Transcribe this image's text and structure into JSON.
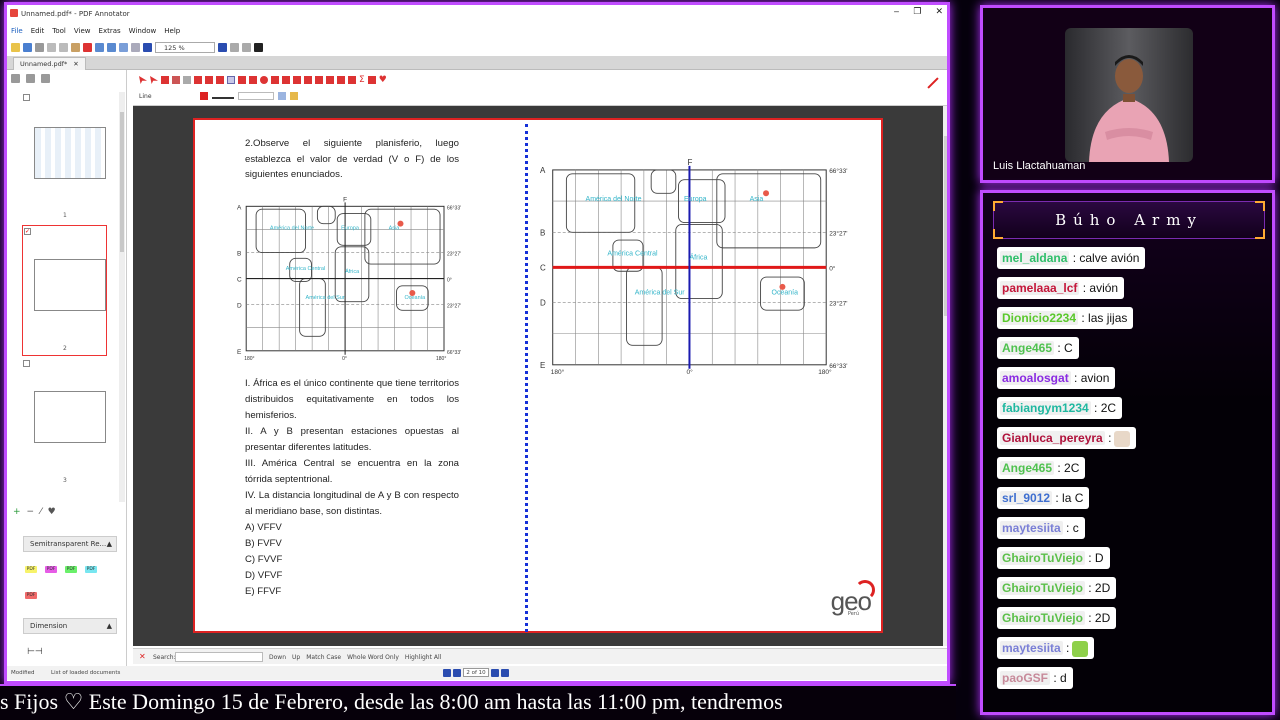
{
  "window": {
    "title": "Unnamed.pdf* - PDF Annotator",
    "controls": [
      "‒",
      "❐",
      "✕"
    ]
  },
  "menu": [
    "File",
    "Edit",
    "Tool",
    "View",
    "Extras",
    "Window",
    "Help"
  ],
  "toolbar": {
    "zoom": "125 %"
  },
  "tab": {
    "label": "Unnamed.pdf*",
    "close": "✕"
  },
  "left_panel": {
    "page_numbers": [
      "1",
      "2",
      "3"
    ],
    "check_mark": "✓",
    "sections": [
      {
        "label": "Semitransparent Re...",
        "caret": "▲"
      },
      {
        "label": "Dimension",
        "caret": "▲"
      }
    ],
    "badge_label": "PDF"
  },
  "annotation_bar": {
    "line_label": "Line"
  },
  "document": {
    "question_intro": "2.Observe el siguiente planisferio, luego establezca el valor de verdad (V o F) de los siguientes enunciados.",
    "statements": [
      "I. África es el único continente que tiene territorios distribuidos equitativamente en todos los hemisferios.",
      "II. A y B presentan estaciones opuestas al presentar diferentes latitudes.",
      "III. América Central se encuentra en la zona tórrida septentrional.",
      "IV. La distancia longitudinal de A y B con respecto al meridiano base, son distintas."
    ],
    "options": [
      "A) VFFV",
      "B) FVFV",
      "C) FVVF",
      "D) VFVF",
      "E) FFVF"
    ],
    "map_small": {
      "row_letters": [
        "A",
        "B",
        "C",
        "D",
        "E"
      ],
      "meridian_letter": "F",
      "lat_labels": [
        "66°33'",
        "23°27'",
        "0°",
        "23°27'",
        "66°33'"
      ],
      "lon_labels": [
        "180°",
        "0°",
        "180°"
      ],
      "continents": [
        "América del Norte",
        "Europa",
        "Asia",
        "América Central",
        "África",
        "América del Sur",
        "Oceanía"
      ]
    },
    "map_large": {
      "row_letters": [
        "A",
        "B",
        "C",
        "D",
        "E"
      ],
      "meridian_letter": "F",
      "lat_labels": [
        "66°33'",
        "23°27'",
        "0°",
        "23°27'",
        "66°33'"
      ],
      "lon_labels": [
        "180°",
        "0°",
        "180°"
      ],
      "continents": [
        "América del Norte",
        "Europa",
        "Asia",
        "América Central",
        "África",
        "América del Sur",
        "Oceanía"
      ]
    },
    "logo": "geo",
    "logo_sub": "Perú"
  },
  "search": {
    "label": "Search:",
    "close": "✕",
    "options": [
      "Down",
      "Up",
      "Match Case",
      "Whole Word Only",
      "Highlight All"
    ]
  },
  "status": {
    "state": "Modified",
    "docs": "List of loaded documents",
    "page": "2 of 10"
  },
  "ticker": {
    "text": "s Fijos ♡        Este Domingo 15 de Febrero, desde las 8:00 am hasta las 11:00 pm, tendremos"
  },
  "webcam": {
    "name": "Luis Llactahuaman"
  },
  "chat": {
    "title": "Búho Army",
    "messages": [
      {
        "user": "mel_aldana",
        "text": ": calve avión",
        "color": "#2fbf6a"
      },
      {
        "user": "pamelaaa_lcf",
        "text": ": avión",
        "color": "#c4163a"
      },
      {
        "user": "Dionicio2234",
        "text": ": las jijas",
        "color": "#5ac92c"
      },
      {
        "user": "Ange465",
        "text": ": C",
        "color": "#4fc24f"
      },
      {
        "user": "amoalosgat",
        "text": ": avion",
        "color": "#8a2be2"
      },
      {
        "user": "fabiangym1234",
        "text": ": 2C",
        "color": "#1fb8a0"
      },
      {
        "user": "Gianluca_pereyra",
        "text": ":",
        "color": "#b0123c"
      },
      {
        "user": "Ange465",
        "text": ": 2C",
        "color": "#4fc24f"
      },
      {
        "user": "srl_9012",
        "text": ": la C",
        "color": "#3f6fd0"
      },
      {
        "user": "maytesiita",
        "text": ": c",
        "color": "#7a7fd6"
      },
      {
        "user": "GhairoTuViejo",
        "text": ": D",
        "color": "#5cc04a"
      },
      {
        "user": "GhairoTuViejo",
        "text": ": 2D",
        "color": "#5cc04a"
      },
      {
        "user": "GhairoTuViejo",
        "text": ": 2D",
        "color": "#5cc04a"
      },
      {
        "user": "maytesiita",
        "text": ":",
        "color": "#7a7fd6"
      },
      {
        "user": "paoGSF",
        "text": ": d",
        "color": "#c78a9a"
      }
    ]
  },
  "colors": {
    "frame_glow": "#c04cff",
    "equator_line": "#e01818",
    "meridian_line": "#1a1ab0",
    "map_label": "#34b5c9",
    "divider": "#1530d8"
  }
}
